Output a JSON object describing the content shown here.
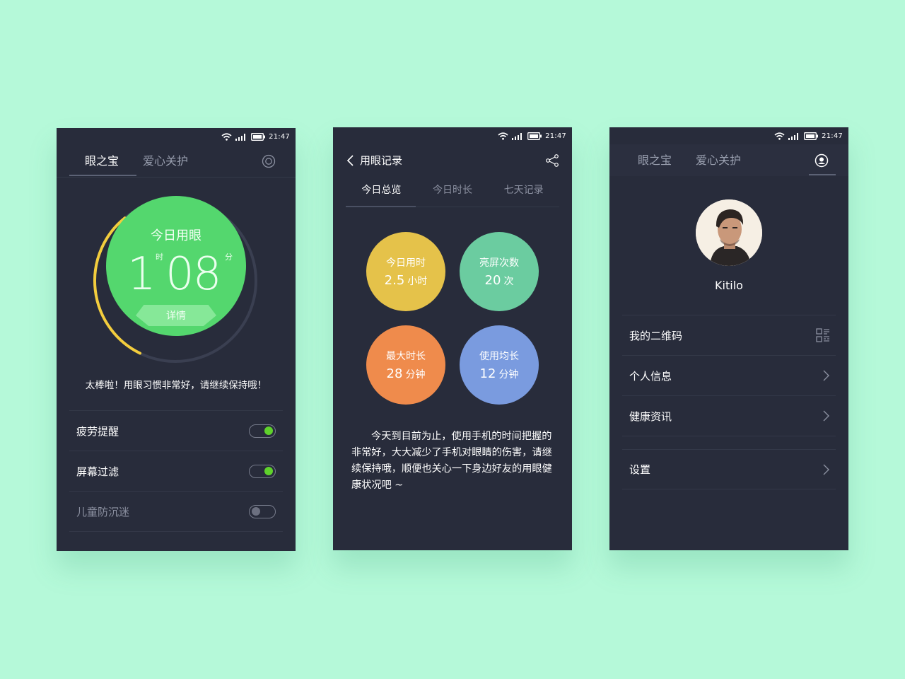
{
  "status": {
    "time": "21:47"
  },
  "screen1": {
    "tabs": [
      "眼之宝",
      "爱心关护"
    ],
    "dial": {
      "title": "今日用眼",
      "hours": "1",
      "hour_unit": "时",
      "minutes": "08",
      "minute_unit": "分",
      "detail": "详情",
      "progress": 0.32
    },
    "praise": "太棒啦！用眼习惯非常好，请继续保持哦！",
    "settings": [
      {
        "label": "疲劳提醒",
        "on": true
      },
      {
        "label": "屏幕过滤",
        "on": true
      },
      {
        "label": "儿童防沉迷",
        "on": false
      }
    ]
  },
  "screen2": {
    "title": "用眼记录",
    "tabs": [
      "今日总览",
      "今日时长",
      "七天记录"
    ],
    "stats": [
      {
        "label": "今日用时",
        "value": "2.5",
        "unit": "小时",
        "color": "#e5c24a"
      },
      {
        "label": "亮屏次数",
        "value": "20",
        "unit": "次",
        "color": "#6bcca0"
      },
      {
        "label": "最大时长",
        "value": "28",
        "unit": "分钟",
        "color": "#ef8b4c"
      },
      {
        "label": "使用均长",
        "value": "12",
        "unit": "分钟",
        "color": "#7a9bdf"
      }
    ],
    "summary": "今天到目前为止，使用手机的时间把握的非常好，大大减少了手机对眼睛的伤害，请继续保持哦，顺便也关心一下身边好友的用眼健康状况吧 ~"
  },
  "screen3": {
    "tabs": [
      "眼之宝",
      "爱心关护"
    ],
    "username": "Kitilo",
    "menu": [
      "我的二维码",
      "个人信息",
      "健康资讯",
      "设置"
    ]
  }
}
